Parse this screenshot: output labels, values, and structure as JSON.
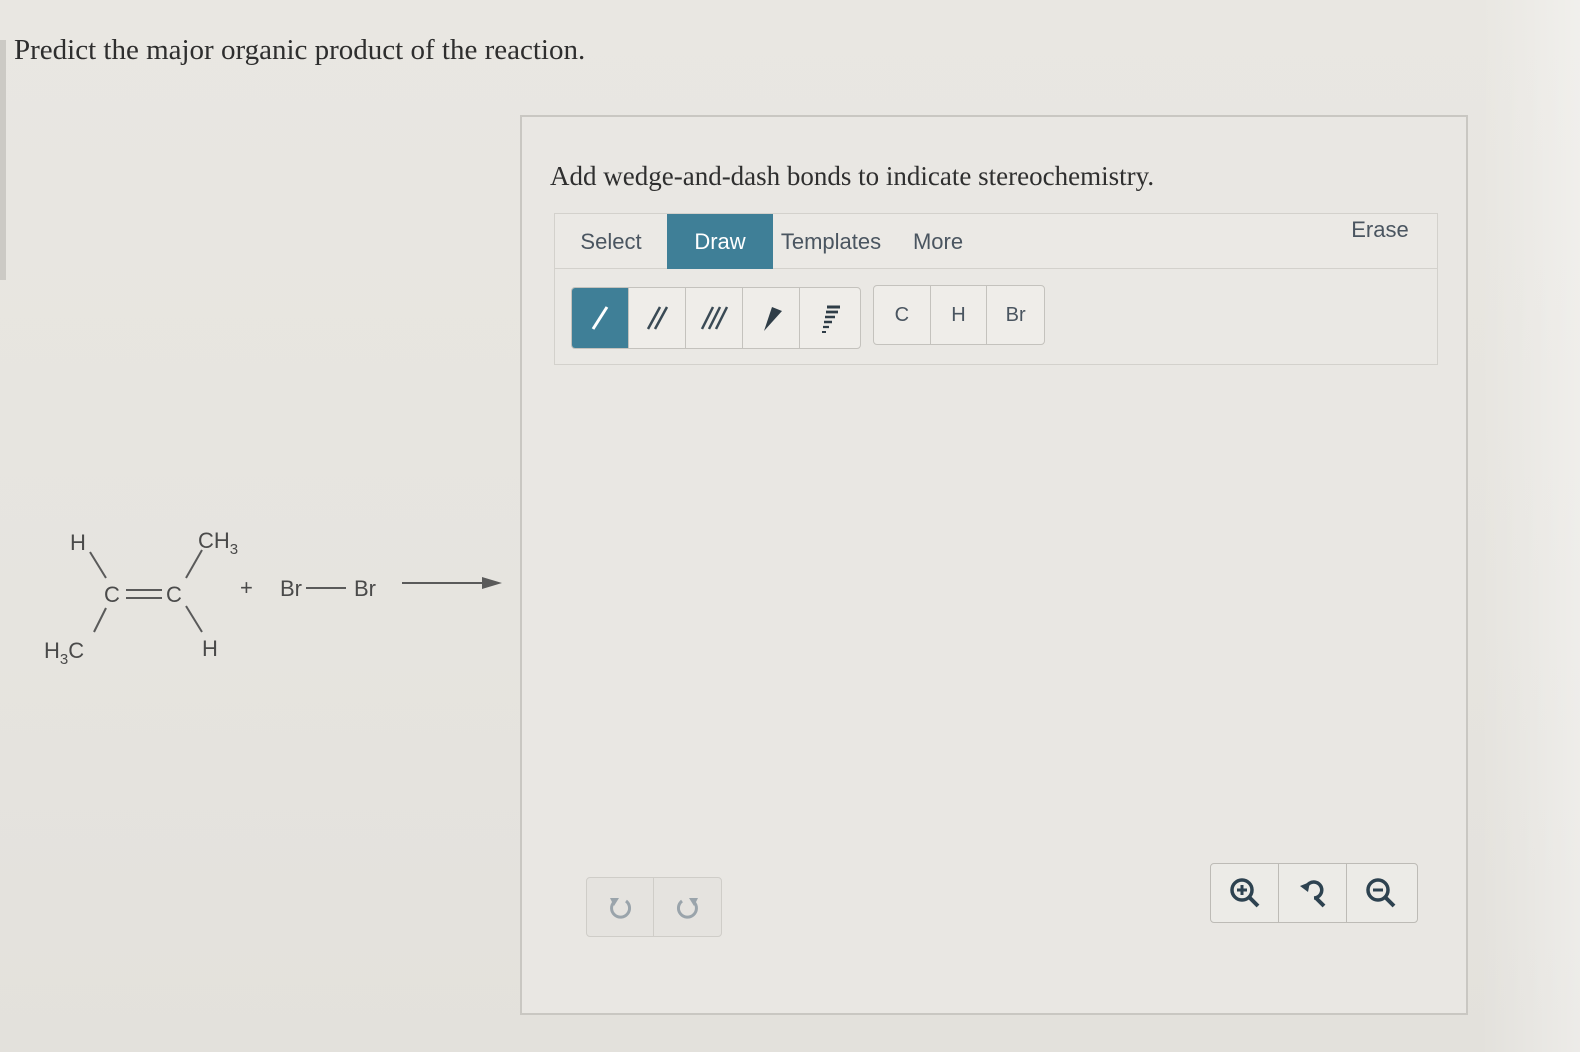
{
  "question": {
    "text": "Predict the major organic product of the reaction."
  },
  "reaction": {
    "reactant1": {
      "top_left": "H",
      "top_right": "CH",
      "top_right_sub": "3",
      "bottom_left": "H",
      "bottom_left_sub": "3",
      "bottom_left_tail": "C",
      "bottom_right": "H",
      "carbon_left": "C",
      "carbon_right": "C"
    },
    "plus": "+",
    "reactant2_left": "Br",
    "reactant2_right": "Br"
  },
  "panel": {
    "instructions": "Add wedge-and-dash bonds to indicate stereochemistry.",
    "tabs": [
      {
        "label": "Select",
        "active": false
      },
      {
        "label": "Draw",
        "active": true
      },
      {
        "label": "Templates",
        "active": false
      },
      {
        "label": "More",
        "active": false
      }
    ],
    "erase_label": "Erase",
    "bond_tools": [
      {
        "icon": "single-bond-icon",
        "active": true
      },
      {
        "icon": "double-bond-icon",
        "active": false
      },
      {
        "icon": "triple-bond-icon",
        "active": false
      },
      {
        "icon": "wedge-bond-icon",
        "active": false
      },
      {
        "icon": "dash-bond-icon",
        "active": false
      }
    ],
    "atom_tools": [
      "C",
      "H",
      "Br"
    ],
    "undo_tools": [
      "undo-icon",
      "redo-icon"
    ],
    "zoom_tools": [
      "zoom-in-icon",
      "reset-zoom-icon",
      "zoom-out-icon"
    ],
    "colors": {
      "accent": "#3f7f97",
      "tab_text": "#4a5560"
    }
  }
}
